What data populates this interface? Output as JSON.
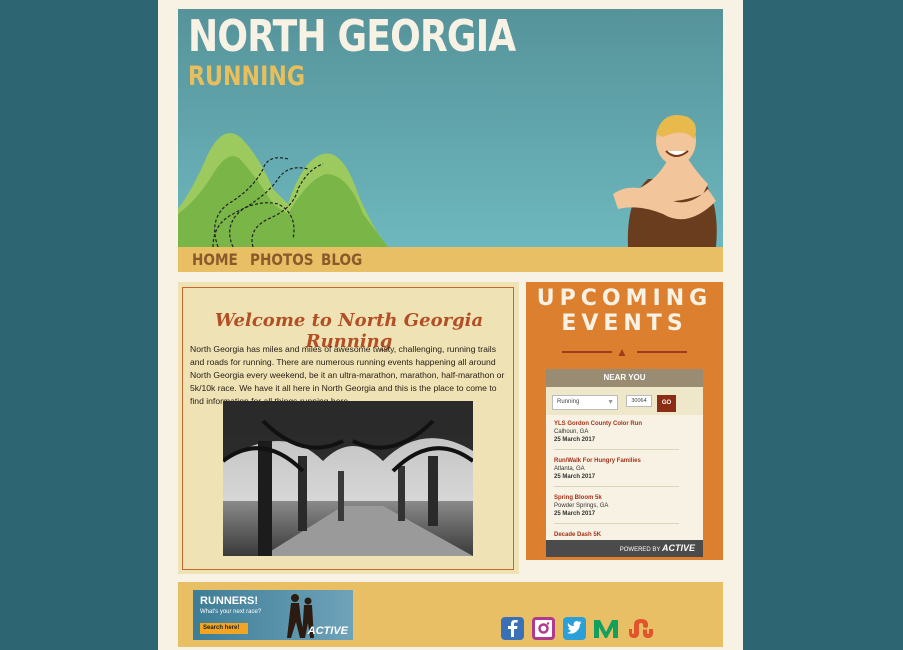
{
  "header": {
    "title": "NORTH GEORGIA",
    "subtitle": "RUNNING"
  },
  "nav": {
    "items": [
      {
        "label": "HOME"
      },
      {
        "label": "PHOTOS"
      },
      {
        "label": "BLOG"
      }
    ]
  },
  "welcome": {
    "title": "Welcome to North Georgia Running",
    "body": "North Georgia has miles and miles of awesome twisty, challenging, running trails and roads for running. There are numerous running events happening all around North Georgia every weekend, be it an ultra-marathon, marathon, half-marathon or 5k/10k race. We have it all here in North Georgia and this is the place to come to find information for all things running here."
  },
  "events": {
    "title_line1": "UPCOMING",
    "title_line2": "EVENTS",
    "widget": {
      "header": "NEAR YOU",
      "activity_select": "Running",
      "zip_value": "30064",
      "go_label": "GO",
      "items": [
        {
          "name": "YLS Gordon County Color Run",
          "location": "Calhoun, GA",
          "date": "25 March 2017"
        },
        {
          "name": "Run/Walk For Hungry Families",
          "location": "Atlanta, GA",
          "date": "25 March 2017"
        },
        {
          "name": "Spring Bloom 5k",
          "location": "Powder Springs, GA",
          "date": "25 March 2017"
        },
        {
          "name": "Decade Dash 5K",
          "location": "",
          "date": ""
        }
      ],
      "footer_powered": "POWERED BY",
      "footer_brand": "ACTIVE"
    }
  },
  "footer": {
    "ad": {
      "title": "RUNNERS!",
      "subtitle": "What's your next race?",
      "button": "Search here!",
      "brand": "ACTIVE"
    },
    "social": [
      {
        "icon": "facebook-icon",
        "color": "#3b6fb6"
      },
      {
        "icon": "instagram-icon",
        "color": "#b03a8e"
      },
      {
        "icon": "twitter-icon",
        "color": "#2a9fd8"
      },
      {
        "icon": "medium-icon",
        "color": "#12a05c"
      },
      {
        "icon": "stumbleupon-icon",
        "color": "#e2552c"
      }
    ]
  },
  "colors": {
    "background": "#2d6672",
    "page": "#f7f2e4",
    "accent_gold": "#e9bf66",
    "accent_orange": "#dc8030",
    "accent_brown": "#8b5a2b"
  }
}
